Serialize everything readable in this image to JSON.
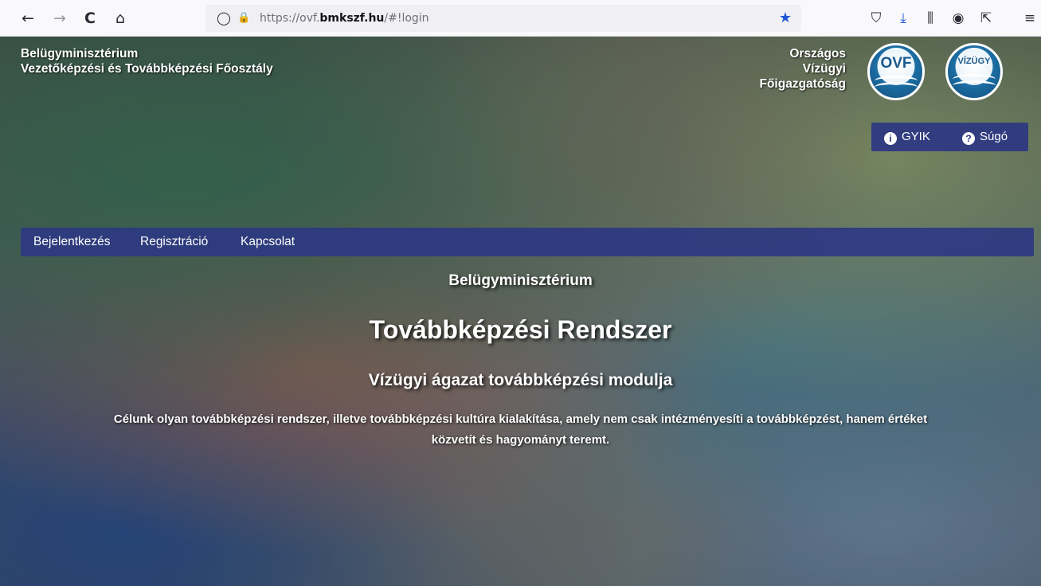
{
  "browser": {
    "back_icon": "←",
    "forward_icon": "→",
    "reload_icon": "C",
    "home_icon": "⌂",
    "shield_icon": "◯",
    "lock_icon": "🔒",
    "url_prefix": "https://ovf.",
    "url_domain": "bmkszf.hu",
    "url_suffix": "/#!login",
    "bookmark_icon": "★",
    "toolbar_icons": [
      "⛉",
      "⤓",
      "⫼",
      "◉",
      "⇱",
      "≡"
    ],
    "accent_color": "#1f57d6"
  },
  "header": {
    "org_line1": "Belügyminisztérium",
    "org_line2": "Vezetőképzési és Továbbképzési Főosztály",
    "right_line1": "Országos",
    "right_line2": "Vízügyi",
    "right_line3": "Főigazgatóság",
    "logo1_text": "OVF",
    "logo2_text": "VÍZÜGY"
  },
  "help_bar": {
    "faq_label": "GYIK",
    "faq_icon": "i",
    "help_label": "Súgó",
    "help_icon": "?",
    "color": "#2c3782"
  },
  "nav": {
    "items": [
      {
        "label": "Bejelentkezés"
      },
      {
        "label": "Regisztráció"
      },
      {
        "label": "Kapcsolat"
      }
    ]
  },
  "hero": {
    "ministry": "Belügyminisztérium",
    "title": "Továbbképzési Rendszer",
    "subtitle": "Vízügyi ágazat továbbképzési modulja",
    "desc_line1": "Célunk olyan továbbképzési rendszer, illetve továbbképzési kultúra kialakítása, amely nem csak intézményesíti a továbbképzést, hanem értéket",
    "desc_line2": "közvetít és hagyományt teremt."
  }
}
